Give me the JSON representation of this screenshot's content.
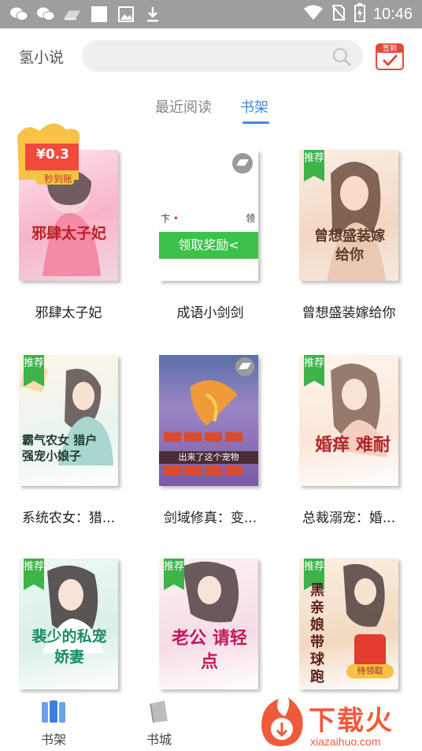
{
  "status_bar": {
    "time": "10:46"
  },
  "header": {
    "app_title": "氢小说",
    "signin_label": "签到"
  },
  "tabs": [
    {
      "label": "最近阅读"
    },
    {
      "label": "书架"
    }
  ],
  "promo": {
    "price": "¥0.3",
    "subtitle": "秒到账"
  },
  "books": [
    {
      "title": "邪肆太子妃",
      "badge": "",
      "cover_text": "邪肆太子妃"
    },
    {
      "title": "成语小剑剑",
      "badge": "",
      "cover_text": "领取奖励<"
    },
    {
      "title": "曾想盛装嫁给你",
      "badge": "推荐",
      "cover_text": "曾想盛装嫁给你"
    },
    {
      "title": "系统农女：猎...",
      "badge": "推荐",
      "cover_text": "霸气农女 猎户 强宠小娘子"
    },
    {
      "title": "剑域修真：变...",
      "badge": "",
      "cover_text": "出来了这个宠物"
    },
    {
      "title": "总裁溺宠：婚...",
      "badge": "推荐",
      "cover_text": "婚痒 难耐"
    },
    {
      "title": "",
      "badge": "推荐",
      "cover_text": "裴少的私宠娇妻"
    },
    {
      "title": "",
      "badge": "推荐",
      "cover_text": "老公 请轻点"
    },
    {
      "title": "",
      "badge": "推荐",
      "cover_text": "黑亲娘带球跑"
    }
  ],
  "cover_meta": {
    "ad_icon_badge": "待领取"
  },
  "nav": [
    {
      "label": "书架"
    },
    {
      "label": "书城"
    }
  ],
  "watermark": {
    "text": "下载火",
    "url": "xiazaihuo.com"
  },
  "colors": {
    "accent": "#3b8ae0",
    "badge": "#3db34a",
    "promo": "#f0463a",
    "status": "#9e9e9e"
  }
}
